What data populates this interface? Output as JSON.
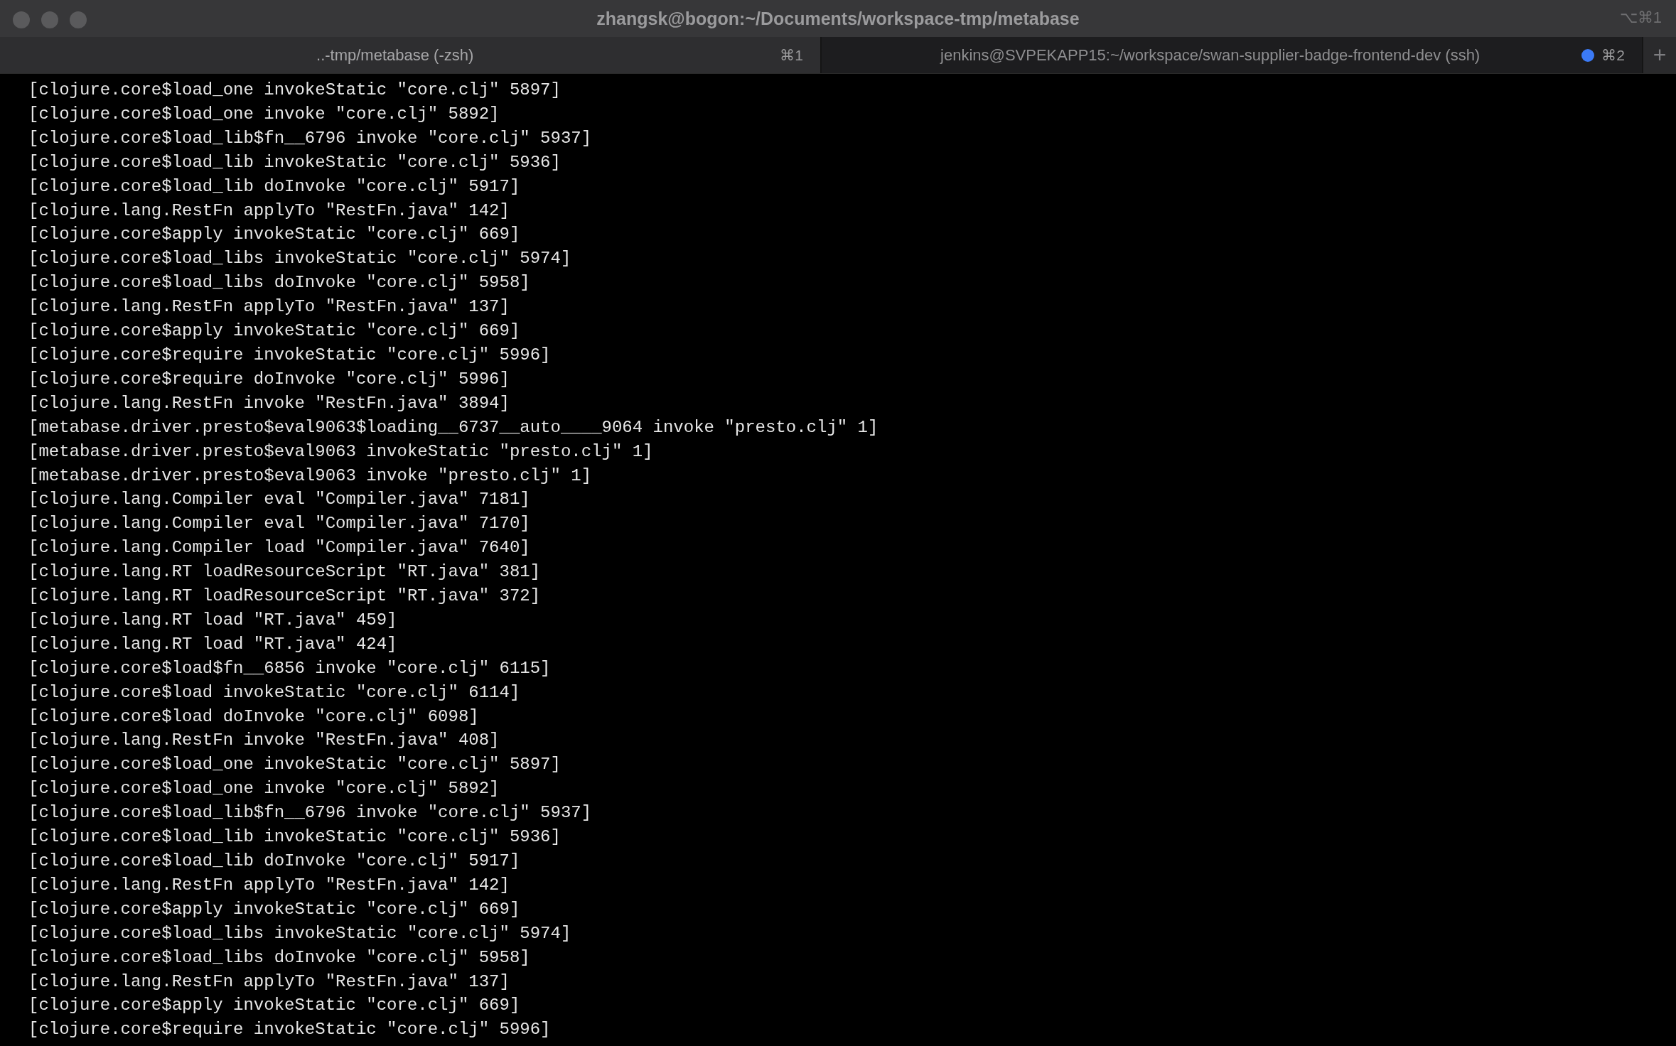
{
  "window": {
    "title": "zhangsk@bogon:~/Documents/workspace-tmp/metabase",
    "shortcut": "⌥⌘1"
  },
  "tabs": [
    {
      "label": "..-tmp/metabase (-zsh)",
      "shortcut": "⌘1",
      "selected": true,
      "activity": false
    },
    {
      "label": "jenkins@SVPEKAPP15:~/workspace/swan-supplier-badge-frontend-dev (ssh)",
      "shortcut": "⌘2",
      "selected": false,
      "activity": true
    }
  ],
  "new_tab_button": "+",
  "terminal_lines": [
    "[clojure.core$load_one invokeStatic \"core.clj\" 5897]",
    "[clojure.core$load_one invoke \"core.clj\" 5892]",
    "[clojure.core$load_lib$fn__6796 invoke \"core.clj\" 5937]",
    "[clojure.core$load_lib invokeStatic \"core.clj\" 5936]",
    "[clojure.core$load_lib doInvoke \"core.clj\" 5917]",
    "[clojure.lang.RestFn applyTo \"RestFn.java\" 142]",
    "[clojure.core$apply invokeStatic \"core.clj\" 669]",
    "[clojure.core$load_libs invokeStatic \"core.clj\" 5974]",
    "[clojure.core$load_libs doInvoke \"core.clj\" 5958]",
    "[clojure.lang.RestFn applyTo \"RestFn.java\" 137]",
    "[clojure.core$apply invokeStatic \"core.clj\" 669]",
    "[clojure.core$require invokeStatic \"core.clj\" 5996]",
    "[clojure.core$require doInvoke \"core.clj\" 5996]",
    "[clojure.lang.RestFn invoke \"RestFn.java\" 3894]",
    "[metabase.driver.presto$eval9063$loading__6737__auto____9064 invoke \"presto.clj\" 1]",
    "[metabase.driver.presto$eval9063 invokeStatic \"presto.clj\" 1]",
    "[metabase.driver.presto$eval9063 invoke \"presto.clj\" 1]",
    "[clojure.lang.Compiler eval \"Compiler.java\" 7181]",
    "[clojure.lang.Compiler eval \"Compiler.java\" 7170]",
    "[clojure.lang.Compiler load \"Compiler.java\" 7640]",
    "[clojure.lang.RT loadResourceScript \"RT.java\" 381]",
    "[clojure.lang.RT loadResourceScript \"RT.java\" 372]",
    "[clojure.lang.RT load \"RT.java\" 459]",
    "[clojure.lang.RT load \"RT.java\" 424]",
    "[clojure.core$load$fn__6856 invoke \"core.clj\" 6115]",
    "[clojure.core$load invokeStatic \"core.clj\" 6114]",
    "[clojure.core$load doInvoke \"core.clj\" 6098]",
    "[clojure.lang.RestFn invoke \"RestFn.java\" 408]",
    "[clojure.core$load_one invokeStatic \"core.clj\" 5897]",
    "[clojure.core$load_one invoke \"core.clj\" 5892]",
    "[clojure.core$load_lib$fn__6796 invoke \"core.clj\" 5937]",
    "[clojure.core$load_lib invokeStatic \"core.clj\" 5936]",
    "[clojure.core$load_lib doInvoke \"core.clj\" 5917]",
    "[clojure.lang.RestFn applyTo \"RestFn.java\" 142]",
    "[clojure.core$apply invokeStatic \"core.clj\" 669]",
    "[clojure.core$load_libs invokeStatic \"core.clj\" 5974]",
    "[clojure.core$load_libs doInvoke \"core.clj\" 5958]",
    "[clojure.lang.RestFn applyTo \"RestFn.java\" 137]",
    "[clojure.core$apply invokeStatic \"core.clj\" 669]",
    "[clojure.core$require invokeStatic \"core.clj\" 5996]"
  ]
}
